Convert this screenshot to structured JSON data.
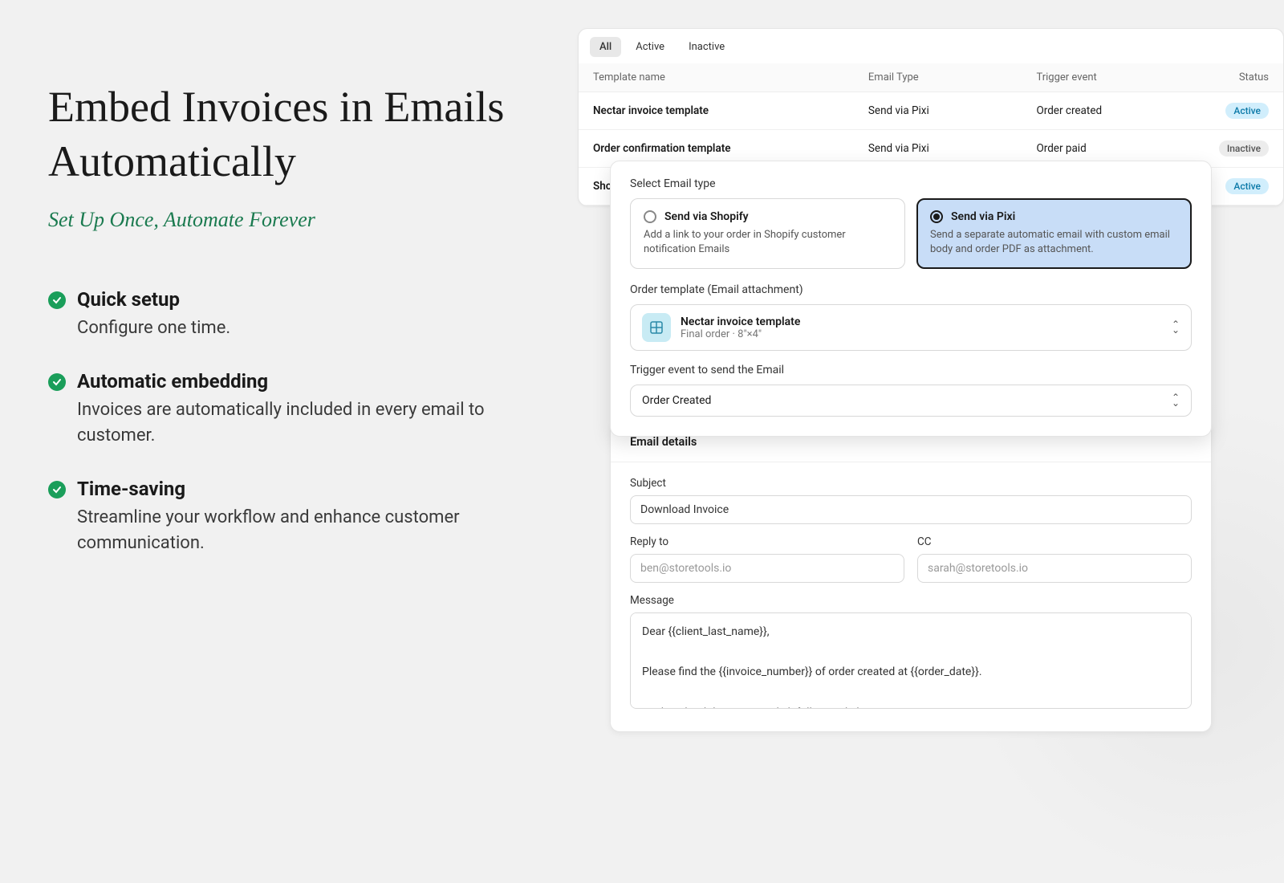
{
  "hero": {
    "headline": "Embed Invoices in Emails Automatically",
    "subheadline": "Set Up Once, Automate Forever"
  },
  "features": [
    {
      "title": "Quick setup",
      "desc": "Configure one time."
    },
    {
      "title": "Automatic embedding",
      "desc": "Invoices are automatically included in every email to customer."
    },
    {
      "title": "Time-saving",
      "desc": "Streamline your workflow and enhance customer communication."
    }
  ],
  "tabs": {
    "all": "All",
    "active": "Active",
    "inactive": "Inactive"
  },
  "table": {
    "headers": {
      "name": "Template name",
      "type": "Email Type",
      "trigger": "Trigger event",
      "status": "Status"
    },
    "rows": [
      {
        "name": "Nectar invoice template",
        "type": "Send via Pixi",
        "trigger": "Order created",
        "status": "Active",
        "status_class": "active"
      },
      {
        "name": "Order confirmation template",
        "type": "Send via Pixi",
        "trigger": "Order paid",
        "status": "Inactive",
        "status_class": "inactive"
      },
      {
        "name": "Shopi",
        "type": "",
        "trigger": "",
        "status": "Active",
        "status_class": "active"
      }
    ]
  },
  "config": {
    "email_type_label": "Select Email type",
    "option_shopify": {
      "title": "Send via Shopify",
      "desc": "Add a link to your order in Shopify customer notification Emails"
    },
    "option_pixi": {
      "title": "Send via Pixi",
      "desc": "Send a separate automatic email with custom email body and order PDF as attachment."
    },
    "template_label": "Order template (Email attachment)",
    "template": {
      "name": "Nectar invoice template",
      "meta": "Final order  ·  8″×4″"
    },
    "trigger_label": "Trigger event to send the Email",
    "trigger_value": "Order Created"
  },
  "email": {
    "card_title": "Email details",
    "subject_label": "Subject",
    "subject_value": "Download Invoice",
    "reply_label": "Reply to",
    "reply_placeholder": "ben@storetools.io",
    "cc_label": "CC",
    "cc_placeholder": "sarah@storetools.io",
    "message_label": "Message",
    "message_value": "Dear {{client_last_name}},\n\nPlease find the {{invoice_number}} of order created at {{order_date}}.\n\nTo download this invoice, click following link:"
  }
}
